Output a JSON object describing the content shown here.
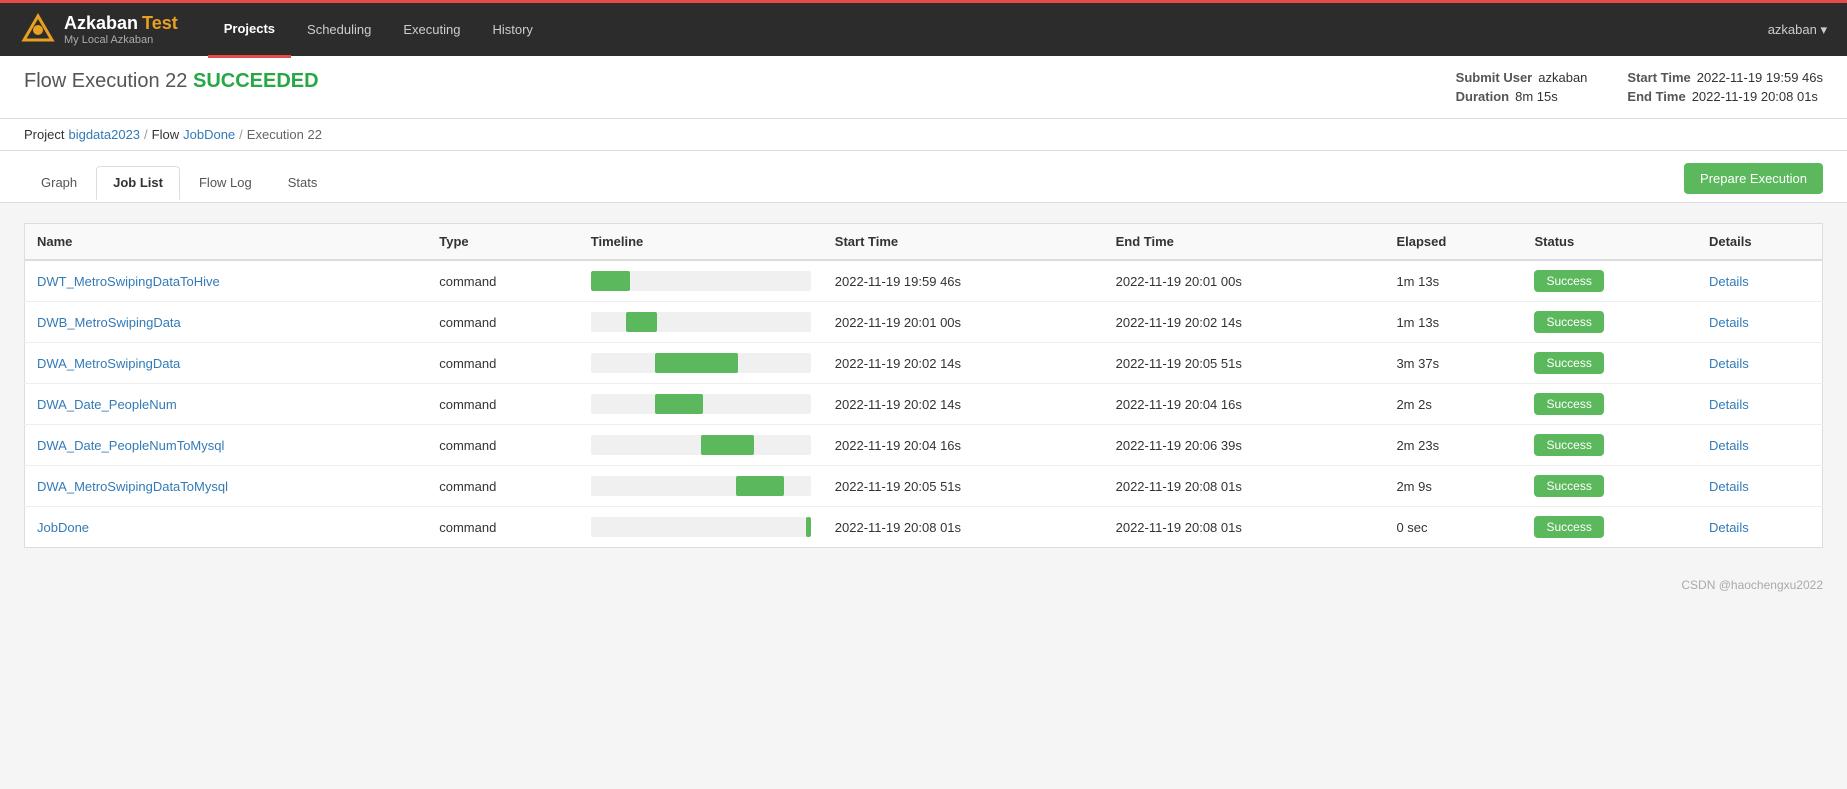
{
  "navbar": {
    "brand": "Azkaban",
    "brand_env": "Test",
    "brand_subtitle": "My Local Azkaban",
    "links": [
      {
        "label": "Projects",
        "active": true
      },
      {
        "label": "Scheduling",
        "active": false
      },
      {
        "label": "Executing",
        "active": false
      },
      {
        "label": "History",
        "active": false
      }
    ],
    "user": "azkaban"
  },
  "header": {
    "title_prefix": "Flow Execution 22",
    "title_status": "SUCCEEDED",
    "submit_user_label": "Submit User",
    "submit_user_value": "azkaban",
    "duration_label": "Duration",
    "duration_value": "8m 15s",
    "start_time_label": "Start Time",
    "start_time_value": "2022-11-19 19:59 46s",
    "end_time_label": "End Time",
    "end_time_value": "2022-11-19 20:08 01s"
  },
  "breadcrumb": {
    "project_label": "Project",
    "project_name": "bigdata2023",
    "flow_label": "Flow",
    "flow_name": "JobDone",
    "execution_label": "Execution",
    "execution_num": "22"
  },
  "tabs": {
    "items": [
      {
        "label": "Graph",
        "active": false
      },
      {
        "label": "Job List",
        "active": true
      },
      {
        "label": "Flow Log",
        "active": false
      },
      {
        "label": "Stats",
        "active": false
      }
    ],
    "prepare_btn": "Prepare Execution"
  },
  "table": {
    "headers": [
      "Name",
      "Type",
      "Timeline",
      "Start Time",
      "End Time",
      "Elapsed",
      "Status",
      "Details"
    ],
    "rows": [
      {
        "name": "DWT_MetroSwipingDataToHive",
        "type": "command",
        "timeline_start": 0,
        "timeline_width": 18,
        "start_time": "2022-11-19 19:59 46s",
        "end_time": "2022-11-19 20:01 00s",
        "elapsed": "1m 13s",
        "status": "Success",
        "details": "Details"
      },
      {
        "name": "DWB_MetroSwipingData",
        "type": "command",
        "timeline_start": 16,
        "timeline_width": 14,
        "start_time": "2022-11-19 20:01 00s",
        "end_time": "2022-11-19 20:02 14s",
        "elapsed": "1m 13s",
        "status": "Success",
        "details": "Details"
      },
      {
        "name": "DWA_MetroSwipingData",
        "type": "command",
        "timeline_start": 29,
        "timeline_width": 38,
        "start_time": "2022-11-19 20:02 14s",
        "end_time": "2022-11-19 20:05 51s",
        "elapsed": "3m 37s",
        "status": "Success",
        "details": "Details"
      },
      {
        "name": "DWA_Date_PeopleNum",
        "type": "command",
        "timeline_start": 29,
        "timeline_width": 22,
        "start_time": "2022-11-19 20:02 14s",
        "end_time": "2022-11-19 20:04 16s",
        "elapsed": "2m 2s",
        "status": "Success",
        "details": "Details"
      },
      {
        "name": "DWA_Date_PeopleNumToMysql",
        "type": "command",
        "timeline_start": 50,
        "timeline_width": 24,
        "start_time": "2022-11-19 20:04 16s",
        "end_time": "2022-11-19 20:06 39s",
        "elapsed": "2m 23s",
        "status": "Success",
        "details": "Details"
      },
      {
        "name": "DWA_MetroSwipingDataToMysql",
        "type": "command",
        "timeline_start": 66,
        "timeline_width": 22,
        "start_time": "2022-11-19 20:05 51s",
        "end_time": "2022-11-19 20:08 01s",
        "elapsed": "2m 9s",
        "status": "Success",
        "details": "Details"
      },
      {
        "name": "JobDone",
        "type": "command",
        "timeline_start": 98,
        "timeline_width": 2,
        "start_time": "2022-11-19 20:08 01s",
        "end_time": "2022-11-19 20:08 01s",
        "elapsed": "0 sec",
        "status": "Success",
        "details": "Details"
      }
    ]
  },
  "footer": {
    "note": "CSDN @haochengxu2022"
  }
}
